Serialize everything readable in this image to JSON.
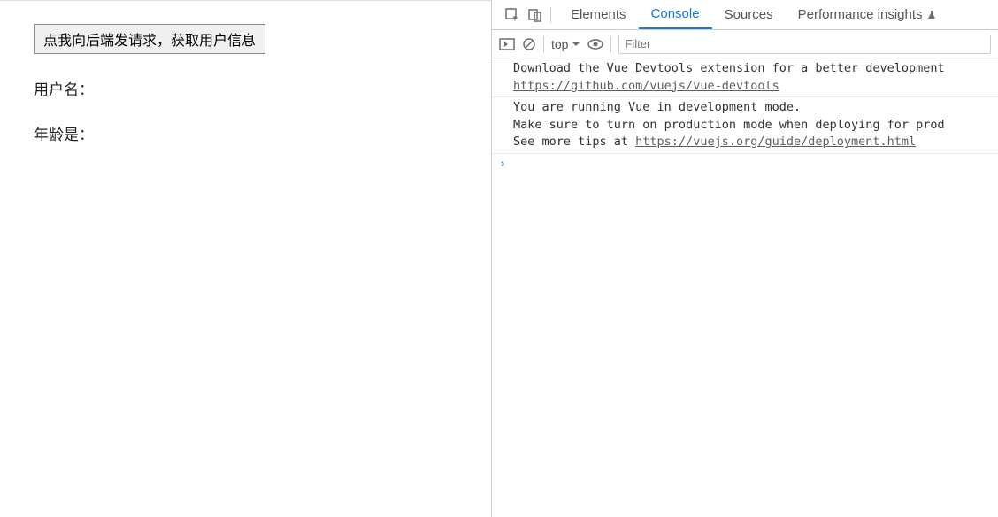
{
  "left": {
    "button_label": "点我向后端发请求，获取用户信息",
    "username_label": "用户名：",
    "age_label": "年龄是："
  },
  "devtools": {
    "tabs": {
      "elements": "Elements",
      "console": "Console",
      "sources": "Sources",
      "performance_insights": "Performance insights"
    },
    "toolbar": {
      "context": "top",
      "filter_placeholder": "Filter"
    },
    "messages": [
      {
        "line1": "Download the Vue Devtools extension for a better development",
        "link1": "https://github.com/vuejs/vue-devtools"
      },
      {
        "line1": "You are running Vue in development mode.",
        "line2": "Make sure to turn on production mode when deploying for prod",
        "line3_prefix": "See more tips at ",
        "link3": "https://vuejs.org/guide/deployment.html"
      }
    ]
  }
}
